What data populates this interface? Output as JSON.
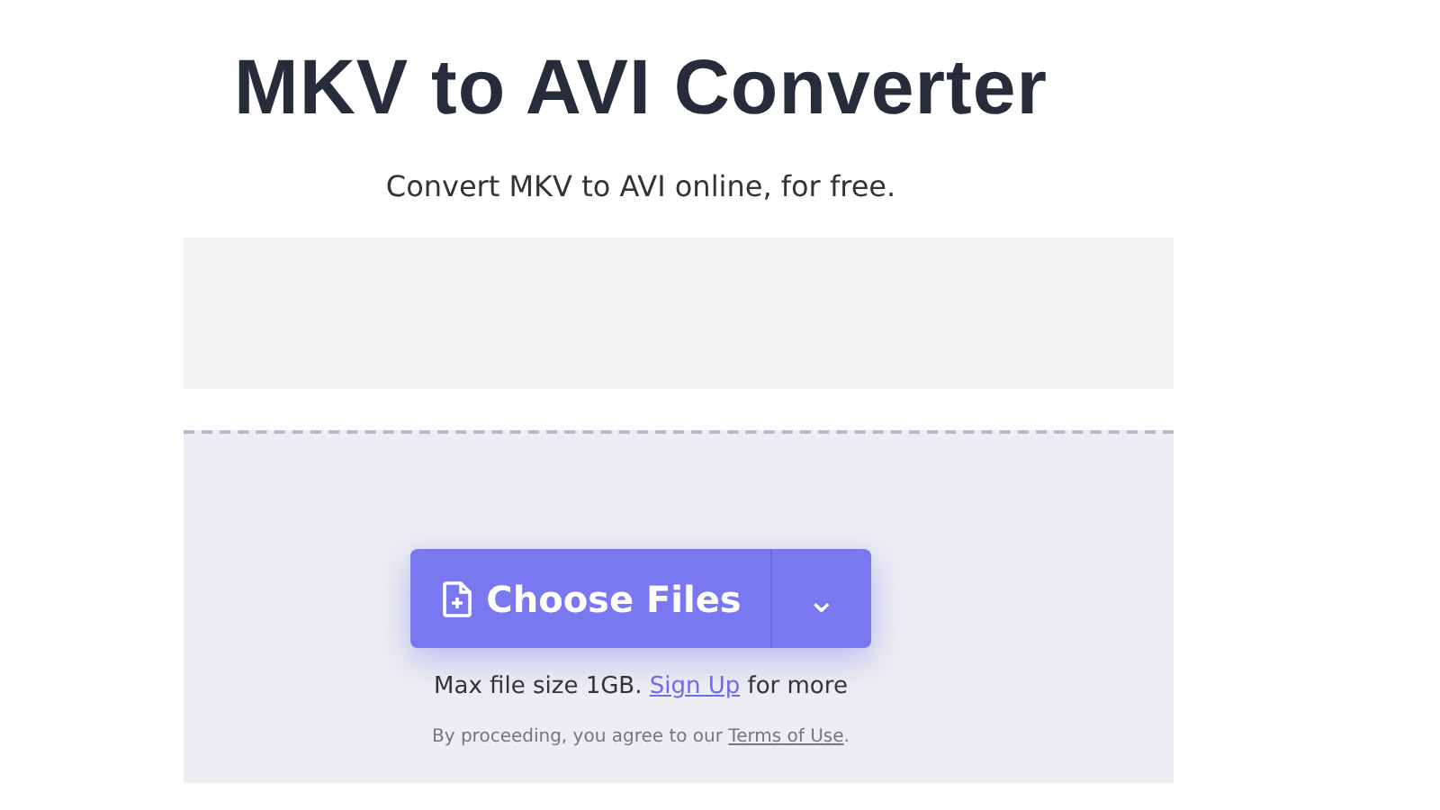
{
  "title": "MKV to AVI Converter",
  "subtitle": "Convert MKV to AVI online, for free.",
  "upload": {
    "button": "Choose Files",
    "dropdown_symbol": "⌄"
  },
  "limit_note": {
    "text": "Max file size 1GB.",
    "link": "Sign Up",
    "after": "for more"
  },
  "terms_note": {
    "text": "By proceeding, you agree to our",
    "link": "Terms of Use",
    "after": "."
  }
}
